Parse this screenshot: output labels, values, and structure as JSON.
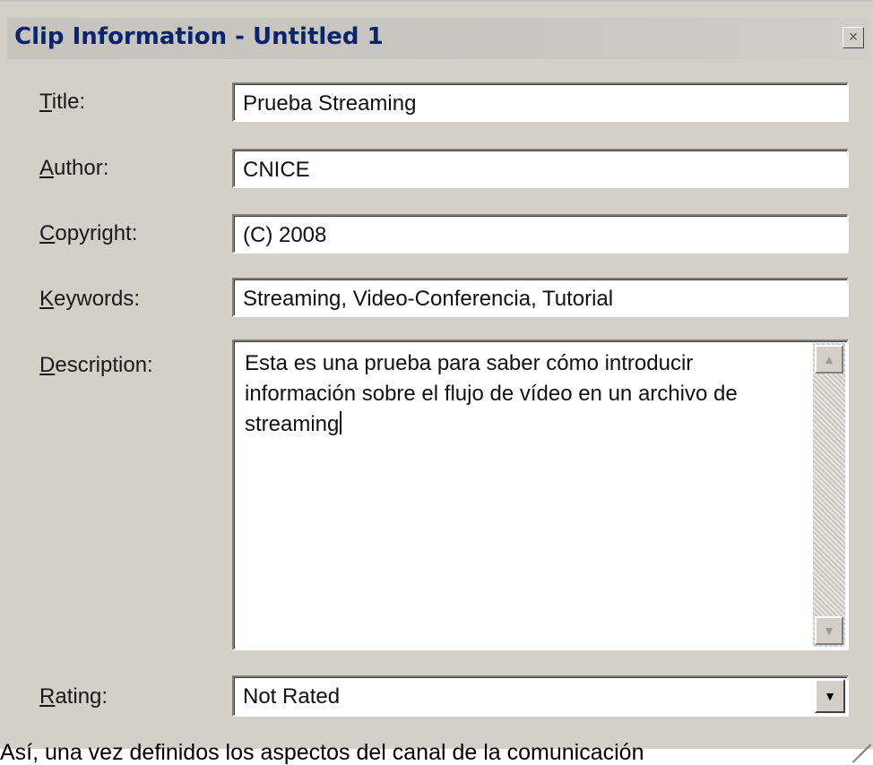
{
  "window": {
    "title": "Clip Information - Untitled 1",
    "close_glyph": "×"
  },
  "fields": {
    "title": {
      "label_key": "T",
      "label_rest": "itle:",
      "value": "Prueba Streaming"
    },
    "author": {
      "label_key": "A",
      "label_rest": "uthor:",
      "value": "CNICE"
    },
    "copyright": {
      "label_key": "C",
      "label_rest": "opyright:",
      "value": "(C) 2008"
    },
    "keywords": {
      "label_key": "K",
      "label_rest": "eywords:",
      "value": "Streaming, Video-Conferencia, Tutorial"
    },
    "description": {
      "label_key": "D",
      "label_rest": "escription:",
      "value": "Esta es una prueba para saber cómo introducir información sobre el flujo de vídeo en un archivo de streaming"
    },
    "rating": {
      "label_key": "R",
      "label_rest": "ating:",
      "value": "Not Rated"
    }
  },
  "icons": {
    "scroll_up": "▲",
    "scroll_down": "▼",
    "dropdown": "▼"
  },
  "caption": "Así, una vez definidos los aspectos del canal de la comunicación"
}
